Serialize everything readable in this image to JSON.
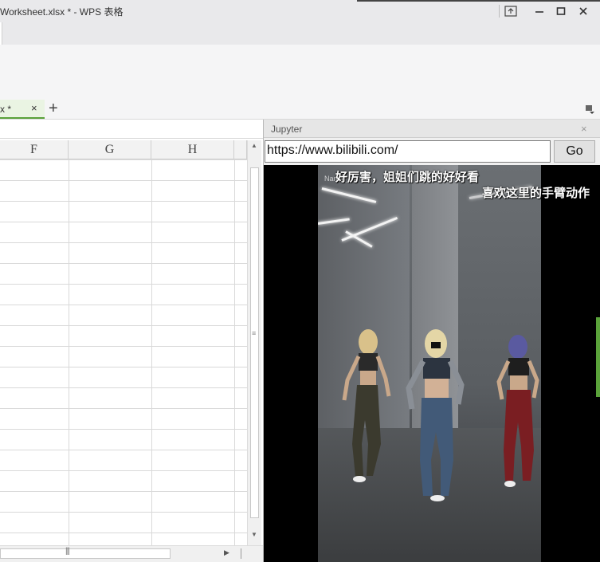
{
  "window": {
    "title": "Worksheet.xlsx * - WPS 表格"
  },
  "tabs": [
    {
      "label": "x *",
      "close": "×"
    }
  ],
  "tab_add": "+",
  "columns": [
    "F",
    "G",
    "H"
  ],
  "jupyter": {
    "title": "Jupyter",
    "close": "×",
    "url": "https://www.bilibili.com/",
    "go_label": "Go",
    "video": {
      "caption_1": "好厉害，姐姐们跳的好好看",
      "caption_2": "喜欢这里的手臂动作",
      "watermark": "Nandu_bili"
    }
  },
  "colors": {
    "accent_green": "#5aa23a",
    "titlebar_bg": "#e9e9eb"
  }
}
